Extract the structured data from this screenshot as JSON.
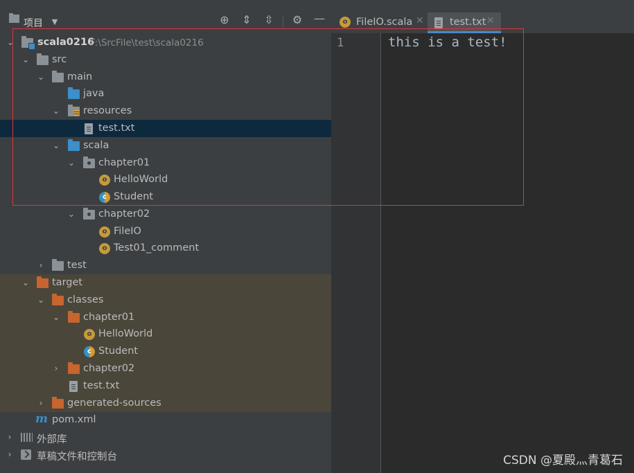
{
  "panel": {
    "title": "项目"
  },
  "tree": [
    {
      "label": "scala0216",
      "path": "F:\\SrcFile\\test\\scala0216"
    },
    {
      "label": "src"
    },
    {
      "label": "main"
    },
    {
      "label": "java"
    },
    {
      "label": "resources"
    },
    {
      "label": "test.txt"
    },
    {
      "label": "scala"
    },
    {
      "label": "chapter01"
    },
    {
      "label": "HelloWorld"
    },
    {
      "label": "Student"
    },
    {
      "label": "chapter02"
    },
    {
      "label": "FileIO"
    },
    {
      "label": "Test01_comment"
    },
    {
      "label": "test"
    },
    {
      "label": "target"
    },
    {
      "label": "classes"
    },
    {
      "label": "chapter01"
    },
    {
      "label": "HelloWorld"
    },
    {
      "label": "Student"
    },
    {
      "label": "chapter02"
    },
    {
      "label": "test.txt"
    },
    {
      "label": "generated-sources"
    },
    {
      "label": "pom.xml"
    },
    {
      "label": "外部库"
    },
    {
      "label": "草稿文件和控制台"
    }
  ],
  "tabs": [
    {
      "label": "FileIO.scala",
      "active": false
    },
    {
      "label": "test.txt",
      "active": true
    }
  ],
  "editor": {
    "line_number": "1",
    "line_text": "this is a test!"
  },
  "watermark": "CSDN @夏殿灬青葛石",
  "colors": {
    "selection": "#0d293e",
    "excluded": "#4a463a",
    "annotation_box": "#e0353a"
  }
}
